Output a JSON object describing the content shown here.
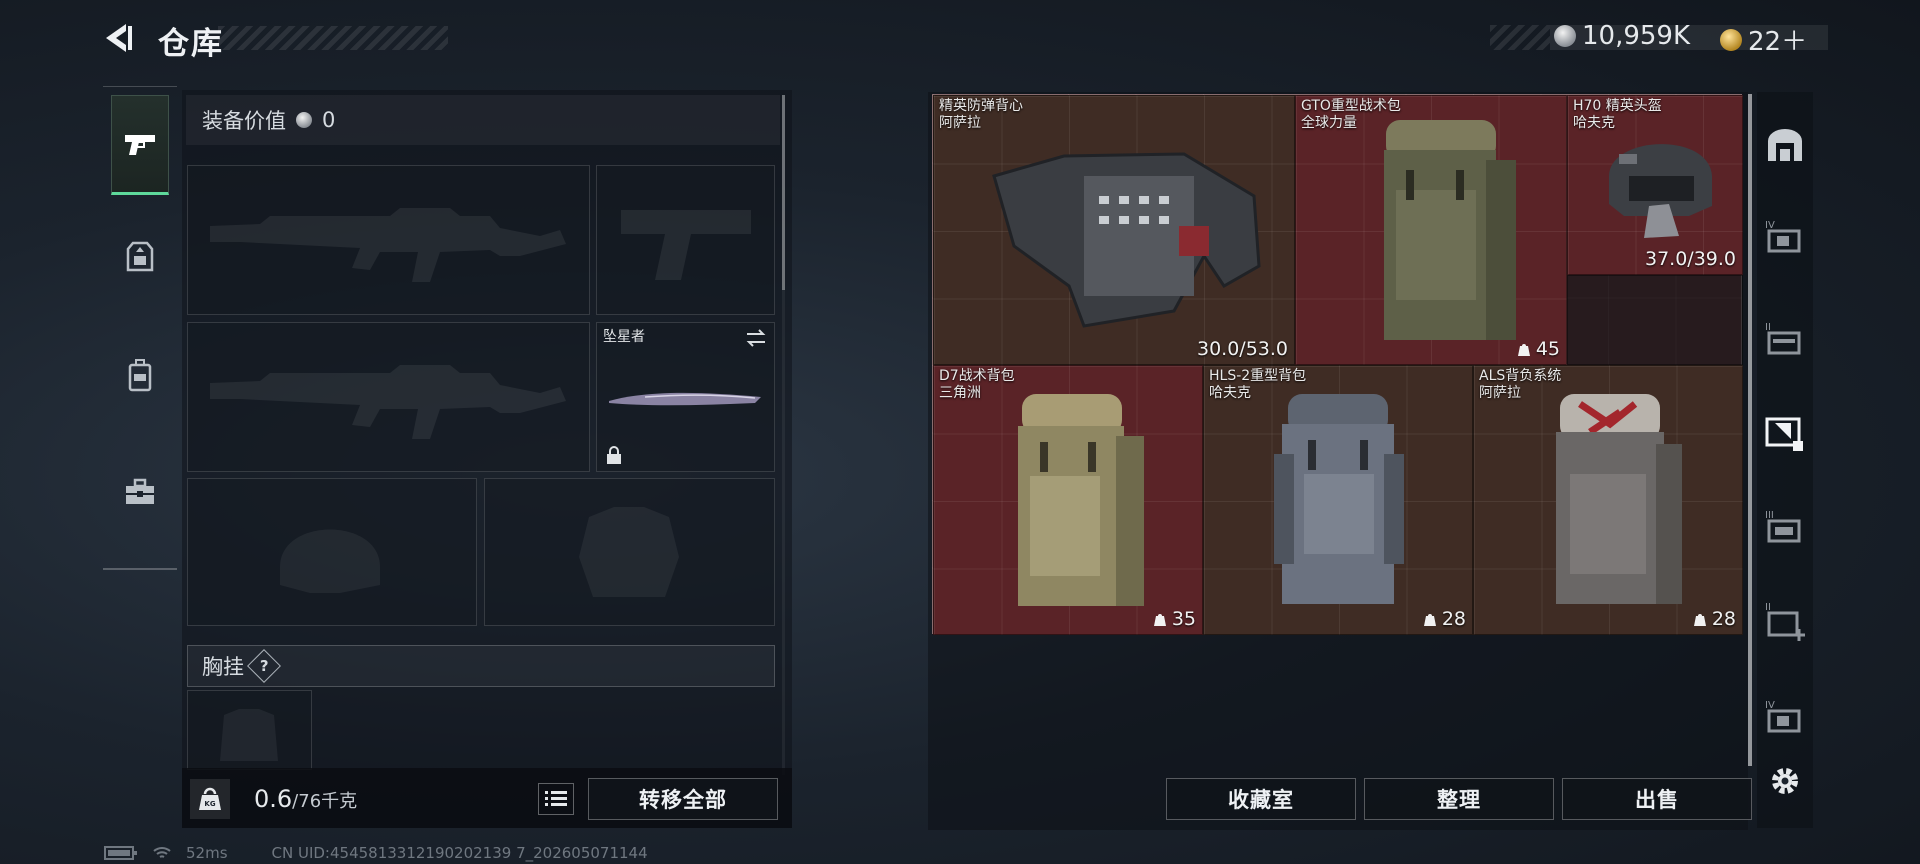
{
  "header": {
    "title": "仓库",
    "currency_silver": "10,959K",
    "currency_gold": "22＋"
  },
  "left_tabs": [
    {
      "name": "weapons",
      "icon": "pistol-icon",
      "active": true
    },
    {
      "name": "armor",
      "icon": "armor-rig-icon",
      "active": false
    },
    {
      "name": "backpack",
      "icon": "backpack-icon",
      "active": false
    },
    {
      "name": "tools",
      "icon": "toolbox-icon",
      "active": false
    }
  ],
  "equipment": {
    "value_label": "装备价值",
    "value": "0",
    "melee_name": "坠星者",
    "chest_rig_label": "胸挂",
    "help_glyph": "?"
  },
  "bottom_bar": {
    "weight_icon_label": "KG",
    "weight_current": "0.6",
    "weight_max": "/76千克",
    "transfer_all_label": "转移全部"
  },
  "storage": {
    "items": [
      {
        "name": "精英防弹背心",
        "sub": "阿萨拉",
        "value": "30.0/53.0",
        "kind": "durability",
        "bg": "brown"
      },
      {
        "name": "GTO重型战术包",
        "sub": "全球力量",
        "value": "45",
        "kind": "capacity",
        "bg": "red"
      },
      {
        "name": "H70 精英头盔",
        "sub": "哈夫克",
        "value": "37.0/39.0",
        "kind": "durability",
        "bg": "red"
      },
      {
        "name": "D7战术背包",
        "sub": "三角洲",
        "value": "35",
        "kind": "capacity",
        "bg": "red"
      },
      {
        "name": "HLS-2重型背包",
        "sub": "哈夫克",
        "value": "28",
        "kind": "capacity",
        "bg": "brown"
      },
      {
        "name": "ALS背负系统",
        "sub": "阿萨拉",
        "value": "28",
        "kind": "capacity",
        "bg": "brown"
      }
    ],
    "buttons": {
      "collection": "收藏室",
      "sort": "整理",
      "sell": "出售"
    }
  },
  "right_categories": [
    {
      "icon": "storage-vault-icon",
      "tier": ""
    },
    {
      "icon": "case-iv-icon",
      "tier": "IV"
    },
    {
      "icon": "case-ii-icon",
      "tier": "II"
    },
    {
      "icon": "case-selected-icon",
      "tier": ""
    },
    {
      "icon": "case-iii-icon",
      "tier": "III"
    },
    {
      "icon": "case-ii-add-icon",
      "tier": "II"
    },
    {
      "icon": "case-iv-b-icon",
      "tier": "IV"
    }
  ],
  "status": {
    "ping": "52ms",
    "uid": "CN UID:4545813312190202139 7_202605071144"
  },
  "colors": {
    "accent": "#5ed99b",
    "item_red": "#5a2327",
    "item_brown": "#3f2c24"
  }
}
